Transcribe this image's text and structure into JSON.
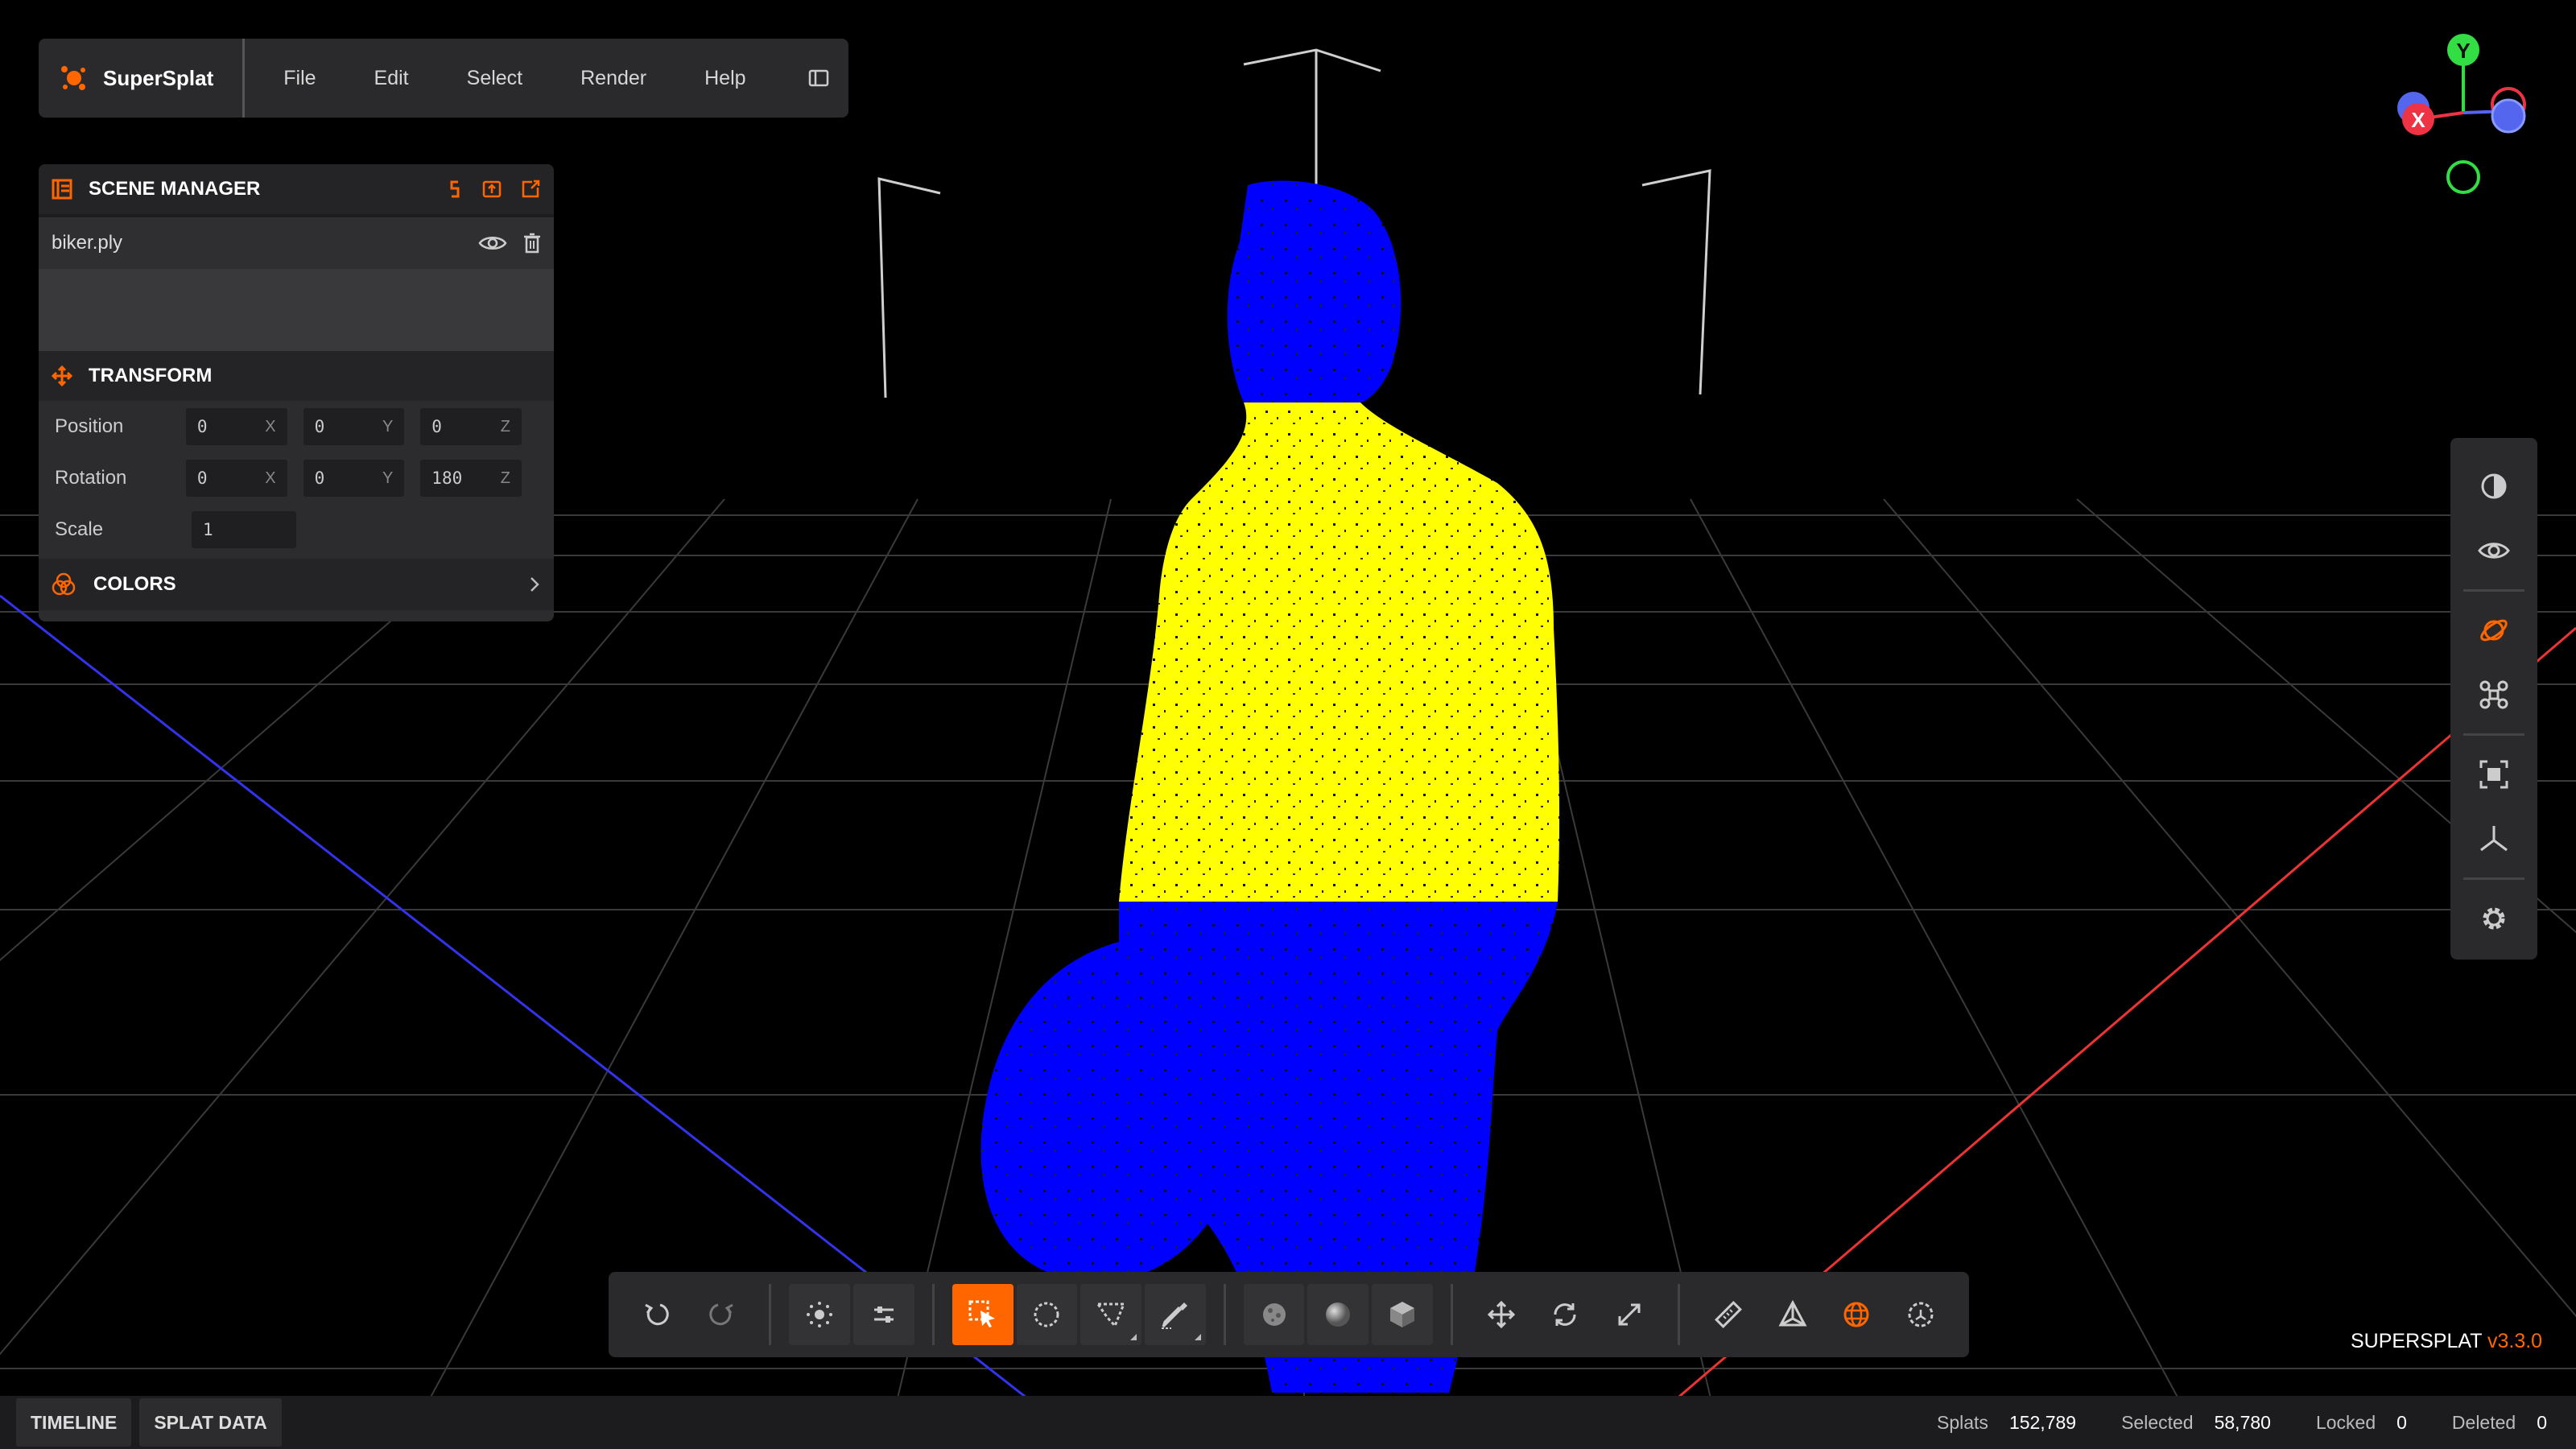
{
  "app": {
    "name": "SuperSplat",
    "brand_color": "#ff6600"
  },
  "menu": {
    "items": [
      {
        "label": "File"
      },
      {
        "label": "Edit"
      },
      {
        "label": "Select"
      },
      {
        "label": "Render"
      },
      {
        "label": "Help"
      }
    ]
  },
  "scene_manager": {
    "title": "SCENE MANAGER",
    "items": [
      {
        "name": "biker.ply"
      }
    ]
  },
  "transform": {
    "title": "TRANSFORM",
    "position": {
      "label": "Position",
      "x": "0",
      "y": "0",
      "z": "0"
    },
    "rotation": {
      "label": "Rotation",
      "x": "0",
      "y": "0",
      "z": "180"
    },
    "scale": {
      "label": "Scale",
      "value": "1"
    },
    "axis_labels": {
      "x": "X",
      "y": "Y",
      "z": "Z"
    }
  },
  "colors": {
    "title": "COLORS"
  },
  "gizmo": {
    "x_label": "X",
    "y_label": "Y",
    "x_color": "#ee3344",
    "y_color": "#33dd44",
    "z_color": "#5566ee"
  },
  "bottom_toolbar": {
    "active_tool": "rect-select",
    "tools": [
      "undo",
      "redo",
      "picker",
      "options",
      "rect-select",
      "lasso",
      "polygon",
      "brush",
      "splat-mode",
      "sphere",
      "box",
      "translate",
      "rotate",
      "scale",
      "measure",
      "axes",
      "world-space",
      "local-space"
    ]
  },
  "right_toolbar": {
    "tools": [
      "display-mode",
      "visibility",
      "orbit",
      "fly",
      "frame",
      "origin",
      "settings"
    ]
  },
  "statusbar": {
    "tabs": [
      {
        "label": "TIMELINE"
      },
      {
        "label": "SPLAT DATA"
      }
    ],
    "splats": {
      "label": "Splats",
      "value": "152,789"
    },
    "selected": {
      "label": "Selected",
      "value": "58,780"
    },
    "locked": {
      "label": "Locked",
      "value": "0"
    },
    "deleted": {
      "label": "Deleted",
      "value": "0"
    }
  },
  "version": {
    "product": "SUPERSPLAT",
    "number": "v3.3.0"
  },
  "palette": {
    "selected_splat": "#ffff00",
    "splat": "#0000ff",
    "grid": "#3a3a3a"
  }
}
